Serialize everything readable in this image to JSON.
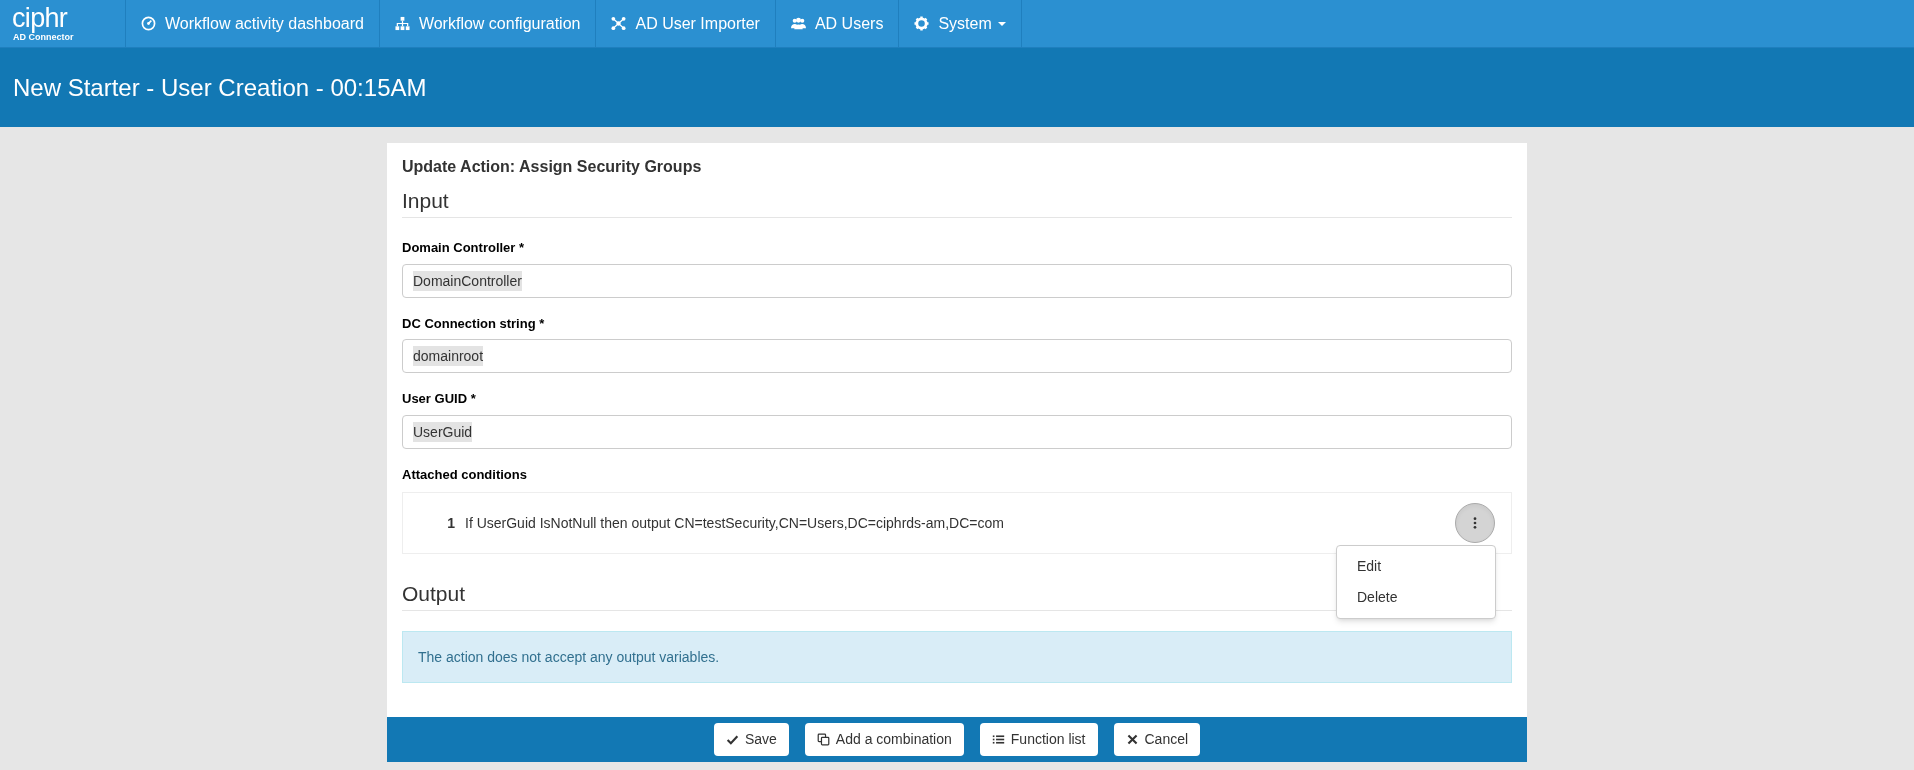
{
  "nav": {
    "logo": "ciphr",
    "logo_subtitle": "AD Connector",
    "items": [
      {
        "label": "Workflow activity dashboard",
        "dropdown": false
      },
      {
        "label": "Workflow configuration",
        "dropdown": false
      },
      {
        "label": "AD User Importer",
        "dropdown": false
      },
      {
        "label": "AD Users",
        "dropdown": false
      },
      {
        "label": "System",
        "dropdown": true
      }
    ]
  },
  "page_title": "New Starter - User Creation - 00:15AM",
  "form": {
    "title": "Update Action: Assign Security Groups",
    "input_heading": "Input",
    "fields": [
      {
        "label": "Domain Controller *",
        "value": "DomainController"
      },
      {
        "label": "DC Connection string *",
        "value": "domainroot"
      },
      {
        "label": "User GUID *",
        "value": "UserGuid"
      }
    ],
    "conditions_label": "Attached conditions",
    "conditions": [
      {
        "number": "1",
        "text": "If UserGuid IsNotNull then output CN=testSecurity,CN=Users,DC=ciphrds-am,DC=com",
        "expanded": true,
        "menu": [
          "Edit",
          "Delete"
        ]
      }
    ],
    "output_heading": "Output",
    "output_message": "The action does not accept any output variables.",
    "buttons": [
      {
        "label": "Save"
      },
      {
        "label": "Add a combination"
      },
      {
        "label": "Function list"
      },
      {
        "label": "Cancel"
      }
    ]
  }
}
